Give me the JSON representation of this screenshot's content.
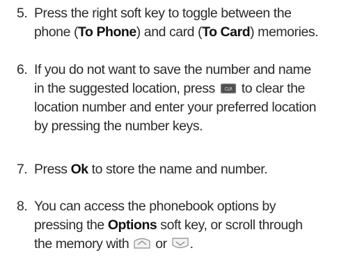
{
  "steps": [
    {
      "number": "5.",
      "line1": "Press the right soft key to toggle between the",
      "line2_prefix": "phone (",
      "to_phone": "To Phone",
      "line2_middle": ") and card (",
      "to_card": "To Card",
      "line2_suffix": ") memories."
    },
    {
      "number": "6.",
      "line1": "If you do not want to save the number and name",
      "line2_prefix": "in the suggested location, press",
      "line2_suffix": "to clear the",
      "line3": "location number and enter your preferred location",
      "line4": "by pressing the number keys.",
      "icon": "clear-key-icon"
    },
    {
      "number": "7.",
      "prefix": "Press ",
      "ok": "Ok",
      "suffix": " to store the name and number."
    },
    {
      "number": "8.",
      "line1": "You can access the phonebook options by",
      "line2_prefix": "pressing the ",
      "options": "Options",
      "line2_suffix": " soft key, or scroll through",
      "line3_prefix": "the memory with",
      "line3_middle": " or ",
      "line3_suffix": ".",
      "icons": [
        "scroll-up-key-icon",
        "scroll-down-key-icon"
      ]
    }
  ]
}
